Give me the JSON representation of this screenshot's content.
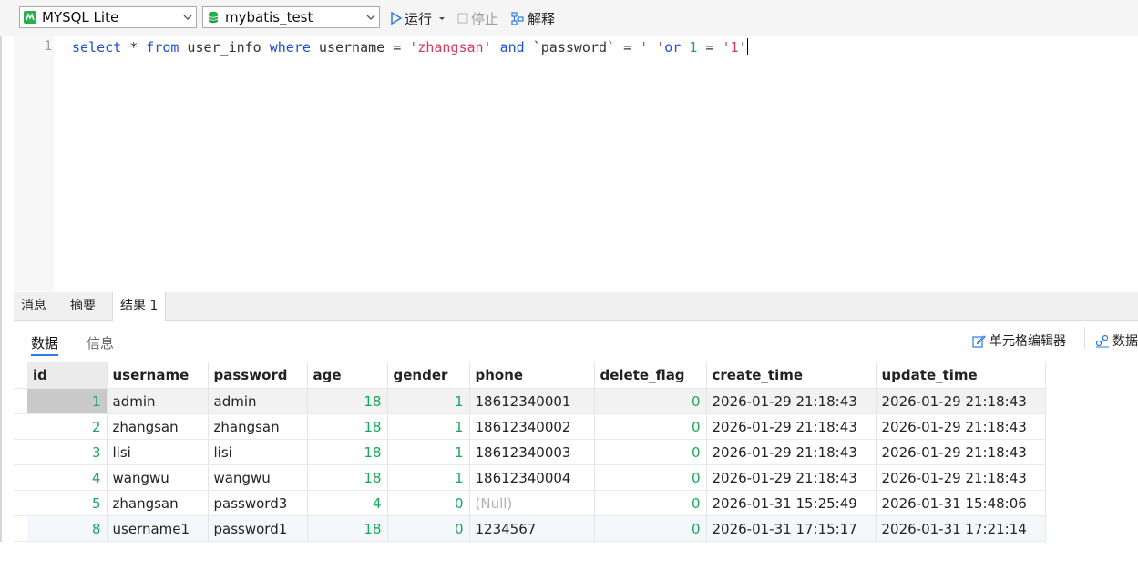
{
  "toolbar": {
    "connection": "MYSQL Lite",
    "database": "mybatis_test",
    "run_label": "运行",
    "stop_label": "停止",
    "explain_label": "解释"
  },
  "editor": {
    "line_number": "1",
    "tokens": [
      {
        "t": "select",
        "c": "kw"
      },
      {
        "t": " * ",
        "c": "plain"
      },
      {
        "t": "from",
        "c": "kw"
      },
      {
        "t": " user_info ",
        "c": "plain"
      },
      {
        "t": "where",
        "c": "kw"
      },
      {
        "t": " username = ",
        "c": "plain"
      },
      {
        "t": "'zhangsan'",
        "c": "str"
      },
      {
        "t": " ",
        "c": "plain"
      },
      {
        "t": "and",
        "c": "kw"
      },
      {
        "t": " `password` = ",
        "c": "plain"
      },
      {
        "t": "' '",
        "c": "str"
      },
      {
        "t": "or",
        "c": "kw"
      },
      {
        "t": " ",
        "c": "plain"
      },
      {
        "t": "1",
        "c": "num"
      },
      {
        "t": " = ",
        "c": "plain"
      },
      {
        "t": "'1'",
        "c": "str"
      }
    ]
  },
  "result_tabs": [
    "消息",
    "摘要",
    "结果 1"
  ],
  "sub_tabs": {
    "data": "数据",
    "info": "信息"
  },
  "right_tools": {
    "cell_editor": "单元格编辑器",
    "data_trunc": "数据"
  },
  "table": {
    "columns": [
      "id",
      "username",
      "password",
      "age",
      "gender",
      "phone",
      "delete_flag",
      "create_time",
      "update_time"
    ],
    "rows": [
      [
        "1",
        "admin",
        "admin",
        "18",
        "1",
        "18612340001",
        "0",
        "2026-01-29 21:18:43",
        "2026-01-29 21:18:43"
      ],
      [
        "2",
        "zhangsan",
        "zhangsan",
        "18",
        "1",
        "18612340002",
        "0",
        "2026-01-29 21:18:43",
        "2026-01-29 21:18:43"
      ],
      [
        "3",
        "lisi",
        "lisi",
        "18",
        "1",
        "18612340003",
        "0",
        "2026-01-29 21:18:43",
        "2026-01-29 21:18:43"
      ],
      [
        "4",
        "wangwu",
        "wangwu",
        "18",
        "1",
        "18612340004",
        "0",
        "2026-01-29 21:18:43",
        "2026-01-29 21:18:43"
      ],
      [
        "5",
        "zhangsan",
        "password3",
        "4",
        "0",
        "(Null)",
        "0",
        "2026-01-31 15:25:49",
        "2026-01-31 15:48:06"
      ],
      [
        "8",
        "username1",
        "password1",
        "18",
        "0",
        "1234567",
        "0",
        "2026-01-31 17:15:17",
        "2026-01-31 17:21:14"
      ]
    ]
  },
  "colors": {
    "keyword": "#1f4fd0",
    "string": "#d63a54",
    "number": "#18a85a",
    "accent": "#2d7be5"
  }
}
